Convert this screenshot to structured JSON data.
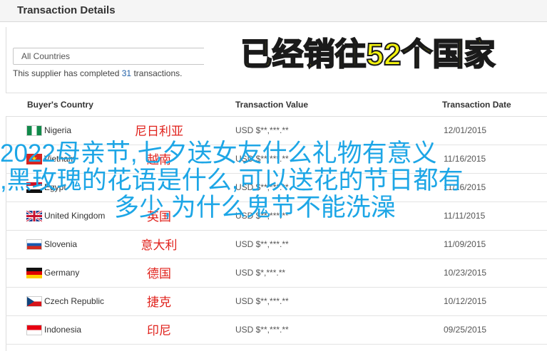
{
  "header": {
    "title": "Transaction Details"
  },
  "filter": {
    "selected": "All Countries"
  },
  "summary": {
    "prefix": "This supplier has completed ",
    "count": "31",
    "suffix": " transactions."
  },
  "table": {
    "headers": {
      "country": "Buyer's Country",
      "value": "Transaction Value",
      "date": "Transaction Date"
    },
    "rows": [
      {
        "country": "Nigeria",
        "value": "USD $**,***.**",
        "date": "12/01/2015",
        "flag": "nigeria-flag-icon",
        "zh": "尼日利亚"
      },
      {
        "country": "Vietnam",
        "value": "USD $**,***.**",
        "date": "11/16/2015",
        "flag": "vietnam-flag-icon",
        "zh": "越南"
      },
      {
        "country": "Egypt",
        "value": "USD $**,***.**",
        "date": "11/16/2015",
        "flag": "egypt-flag-icon",
        "zh": ""
      },
      {
        "country": "United Kingdom",
        "value": "USD $**,***.**",
        "date": "11/11/2015",
        "flag": "uk-flag-icon",
        "zh": "英国"
      },
      {
        "country": "Slovenia",
        "value": "USD $**,***.**",
        "date": "11/09/2015",
        "flag": "slovenia-flag-icon",
        "zh": "意大利"
      },
      {
        "country": "Germany",
        "value": "USD $*,***.**",
        "date": "10/23/2015",
        "flag": "germany-flag-icon",
        "zh": "德国"
      },
      {
        "country": "Czech Republic",
        "value": "USD $**,***.**",
        "date": "10/12/2015",
        "flag": "czech-flag-icon",
        "zh": "捷克"
      },
      {
        "country": "Indonesia",
        "value": "USD $**,***.**",
        "date": "09/25/2015",
        "flag": "indonesia-flag-icon",
        "zh": "印尼"
      }
    ]
  },
  "banner": {
    "text": "已经销往52个国家"
  },
  "overlay": {
    "line1": "2022母亲节,七夕送女友什么礼物有意义",
    "line2": ",黑玫瑰的花语是什么,可以送花的节日都有",
    "line3": "多少,为什么鬼节不能洗澡"
  },
  "colors": {
    "banner_fill": "#f2f20e",
    "overlay_text": "#1da6e6",
    "country_zh": "#e0221c"
  }
}
